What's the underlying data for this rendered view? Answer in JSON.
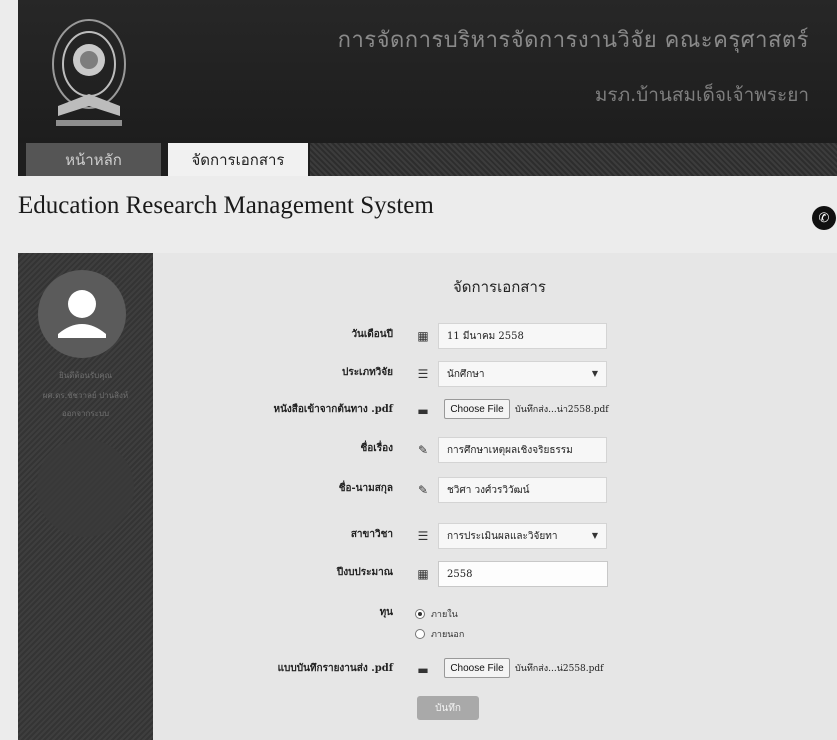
{
  "header": {
    "title": "การจัดการบริหารจัดการงานวิจัย คณะครุศาสตร์",
    "subtitle": "มรภ.บ้านสมเด็จเจ้าพระยา"
  },
  "nav": {
    "home": "หน้าหลัก",
    "docs": "จัดการเอกสาร"
  },
  "app": {
    "title": "Education Research Management System"
  },
  "sidebar": {
    "line1": "ยินดีต้อนรับคุณ",
    "line2": "ผศ.ดร.ชัชวาลย์ ปานสิงห์",
    "line3": "ออกจากระบบ"
  },
  "form": {
    "title": "จัดการเอกสาร",
    "date_label": "วันเดือนปี",
    "date_value": "11 มีนาคม 2558",
    "researcher_label": "ประเภทวิจัย",
    "researcher_value": "นักศึกษา",
    "attach_label": "หนังสือเข้าจากต้นทาง .pdf",
    "choose_file": "Choose File",
    "attach_file_name": "บันทึกส่ง...น่า2558.pdf",
    "subject_label": "ชื่อเรื่อง",
    "subject_value": "การศึกษาเหตุผลเชิงจริยธรรม",
    "name_label": "ชื่อ-นามสกุล",
    "name_value": "ชวิศา วงศ์วรวิวัฒน์",
    "major_label": "สาขาวิชา",
    "major_value": "การประเมินผลและวิจัยทา",
    "year_label": "ปีงบประมาณ",
    "year_value": "2558",
    "fund_label": "ทุน",
    "fund_internal": "ภายใน",
    "fund_external": "ภายนอก",
    "memo_label": "แบบบันทึกรายงานส่ง .pdf",
    "memo_file_name": "บันทึกส่ง...น่2558.pdf",
    "submit": "บันทึก"
  },
  "colors": {
    "header_bg": "#1d1d1d",
    "sidebar_bg": "#3a3a3a",
    "submit_bg": "#a9a9a9"
  }
}
